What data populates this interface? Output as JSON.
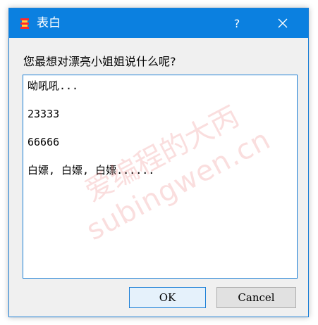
{
  "window": {
    "title": "表白",
    "help_label": "?",
    "close_icon": "close-icon",
    "app_icon": "app-icon"
  },
  "prompt": {
    "label": "您最想对漂亮小姐姐说什么呢?"
  },
  "textarea": {
    "lines": [
      "呦吼吼...",
      "23333",
      "66666",
      "白嫖, 白嫖, 白嫖......"
    ]
  },
  "watermark": {
    "line1": "爱编程的大丙",
    "line2": "subingwen.cn"
  },
  "buttons": {
    "ok_label": "OK",
    "cancel_label": "Cancel"
  },
  "colors": {
    "titlebar": "#0b80e0",
    "focus_border": "#1c7fd6",
    "window_bg": "#f0f0f0"
  }
}
